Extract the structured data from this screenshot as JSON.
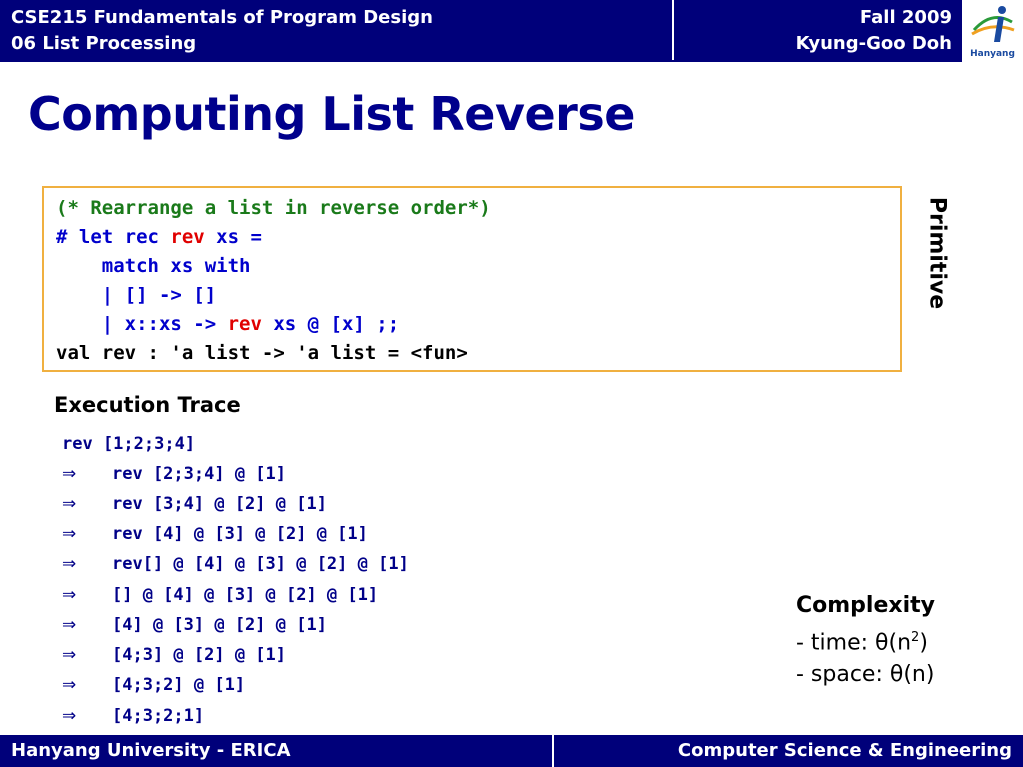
{
  "header": {
    "course": "CSE215 Fundamentals of Program Design",
    "lecture": "06 List Processing",
    "term": "Fall 2009",
    "instructor": "Kyung-Goo Doh",
    "logo_text": "Hanyang"
  },
  "title": "Computing List Reverse",
  "code": {
    "comment": "(* Rearrange a list in reverse order*)",
    "line2_a": "# let rec ",
    "line2_rev": "rev",
    "line2_b": " xs =",
    "line3": "    match xs with",
    "line4": "    | [] -> []",
    "line5_a": "    | x::xs -> ",
    "line5_rev": "rev",
    "line5_b": " xs @ [x] ;;",
    "line6": "val rev : 'a list -> 'a list = <fun>"
  },
  "side_label": "Primitive",
  "execution": {
    "title": "Execution Trace",
    "arrow": "⇒",
    "lines": [
      "rev [1;2;3;4]",
      "rev [2;3;4] @ [1]",
      "rev [3;4] @ [2] @ [1]",
      "rev [4] @ [3] @ [2] @ [1]",
      "rev[] @ [4] @ [3] @ [2] @ [1]",
      "[] @ [4] @ [3] @ [2] @ [1]",
      "[4] @ [3] @ [2] @ [1]",
      "[4;3] @ [2] @ [1]",
      "[4;3;2] @ [1]",
      "[4;3;2;1]"
    ]
  },
  "complexity": {
    "title": "Complexity",
    "time_prefix": "- time: θ(n",
    "time_sup": "2",
    "time_suffix": ")",
    "space": "- space: θ(n)"
  },
  "footer": {
    "left": "Hanyang University - ERICA",
    "right": "Computer Science & Engineering"
  },
  "colors": {
    "navy": "#00007a",
    "title_blue": "#00008c",
    "code_green": "#1a7a1a",
    "code_blue": "#0000cc",
    "code_red": "#e00000",
    "box_border": "#f0b040"
  }
}
